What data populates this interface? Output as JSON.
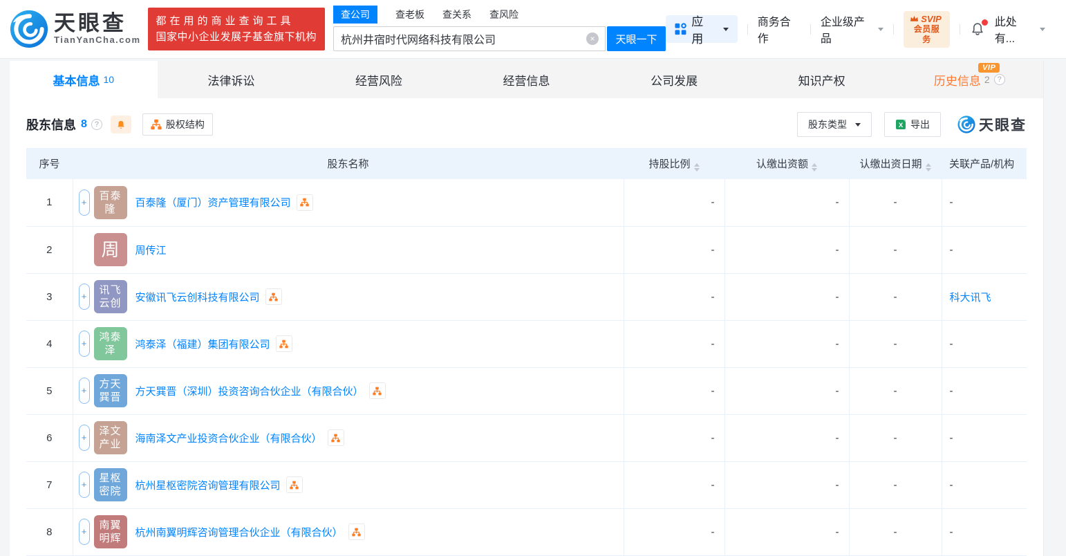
{
  "colors": {
    "accent": "#0084ff",
    "orange": "#ff7b33",
    "promo_red": "#e13b35",
    "link": "#0084ff",
    "table_header_bg": "#ebf3fc",
    "table_border": "#e9f0f9",
    "svip_text": "#e2591a",
    "icon_orange": "#ff7d20"
  },
  "header": {
    "logo": {
      "title": "天眼查",
      "subtitle": "TianYanCha.com"
    },
    "promo": {
      "line1": "都在用的商业查询工具",
      "line2": "国家中小企业发展子基金旗下机构"
    },
    "search": {
      "tabs": [
        {
          "id": "company",
          "label": "查公司",
          "active": true
        },
        {
          "id": "boss",
          "label": "查老板",
          "active": false
        },
        {
          "id": "relation",
          "label": "查关系",
          "active": false
        },
        {
          "id": "risk",
          "label": "查风险",
          "active": false
        }
      ],
      "value": "杭州井宿时代网络科技有限公司",
      "button": "天眼一下"
    },
    "menu": {
      "apps": "应用",
      "cooperation": "商务合作",
      "enterprise": "企业级产品",
      "svip_line1": "SVIP",
      "svip_line2": "会员服务",
      "user": "此处有..."
    }
  },
  "nav": {
    "tabs": [
      {
        "id": "basic-info",
        "label": "基本信息",
        "count": "10",
        "active": true
      },
      {
        "id": "legal",
        "label": "法律诉讼"
      },
      {
        "id": "operation-risk",
        "label": "经营风险"
      },
      {
        "id": "operation-info",
        "label": "经营信息"
      },
      {
        "id": "development",
        "label": "公司发展"
      },
      {
        "id": "intellectual-property",
        "label": "知识产权"
      },
      {
        "id": "history",
        "label": "历史信息",
        "count": "2",
        "orange": true,
        "vip": "VIP",
        "help": true
      }
    ]
  },
  "section": {
    "title": "股东信息",
    "count": "8",
    "equity_structure": "股权结构",
    "shareholder_type": "股东类型",
    "export": "导出",
    "watermark": "天眼查"
  },
  "table": {
    "columns": [
      {
        "label": "序号",
        "sortable": false
      },
      {
        "label": "股东名称",
        "sortable": false
      },
      {
        "label": "持股比例",
        "sortable": true
      },
      {
        "label": "认缴出资额",
        "sortable": true
      },
      {
        "label": "认缴出资日期",
        "sortable": true
      },
      {
        "label": "关联产品/机构",
        "sortable": false
      }
    ],
    "rows": [
      {
        "no": "1",
        "expand": true,
        "avatar": {
          "lines": [
            "百泰",
            "隆"
          ],
          "color": "#c5a294"
        },
        "name": "百泰隆（厦门）资产管理有限公司",
        "chart": true,
        "ratio": "-",
        "amount": "-",
        "date": "-",
        "related": "-",
        "related_link": false
      },
      {
        "no": "2",
        "expand": false,
        "avatar": {
          "lines": [
            "周"
          ],
          "color": "#c9908f"
        },
        "name": "周传江",
        "chart": false,
        "ratio": "-",
        "amount": "-",
        "date": "-",
        "related": "-",
        "related_link": false
      },
      {
        "no": "3",
        "expand": true,
        "avatar": {
          "lines": [
            "讯飞",
            "云创"
          ],
          "color": "#9097c2"
        },
        "name": "安徽讯飞云创科技有限公司",
        "chart": true,
        "ratio": "-",
        "amount": "-",
        "date": "-",
        "related": "科大讯飞",
        "related_link": true
      },
      {
        "no": "4",
        "expand": true,
        "avatar": {
          "lines": [
            "鸿泰",
            "泽"
          ],
          "color": "#80c79b"
        },
        "name": "鸿泰泽（福建）集团有限公司",
        "chart": true,
        "ratio": "-",
        "amount": "-",
        "date": "-",
        "related": "-",
        "related_link": false
      },
      {
        "no": "5",
        "expand": true,
        "avatar": {
          "lines": [
            "方天",
            "巽晋"
          ],
          "color": "#6fa7da"
        },
        "name": "方天巽晋（深圳）投资咨询合伙企业（有限合伙）",
        "chart": true,
        "ratio": "-",
        "amount": "-",
        "date": "-",
        "related": "-",
        "related_link": false
      },
      {
        "no": "6",
        "expand": true,
        "avatar": {
          "lines": [
            "泽文",
            "产业"
          ],
          "color": "#c5a294"
        },
        "name": "海南泽文产业投资合伙企业（有限合伙）",
        "chart": true,
        "ratio": "-",
        "amount": "-",
        "date": "-",
        "related": "-",
        "related_link": false
      },
      {
        "no": "7",
        "expand": true,
        "avatar": {
          "lines": [
            "星枢",
            "密院"
          ],
          "color": "#6fa7da"
        },
        "name": "杭州星枢密院咨询管理有限公司",
        "chart": true,
        "ratio": "-",
        "amount": "-",
        "date": "-",
        "related": "-",
        "related_link": false
      },
      {
        "no": "8",
        "expand": true,
        "avatar": {
          "lines": [
            "南翼",
            "明辉"
          ],
          "color": "#c27b7b"
        },
        "name": "杭州南翼明辉咨询管理合伙企业（有限合伙）",
        "chart": true,
        "ratio": "-",
        "amount": "-",
        "date": "-",
        "related": "-",
        "related_link": false
      }
    ]
  }
}
